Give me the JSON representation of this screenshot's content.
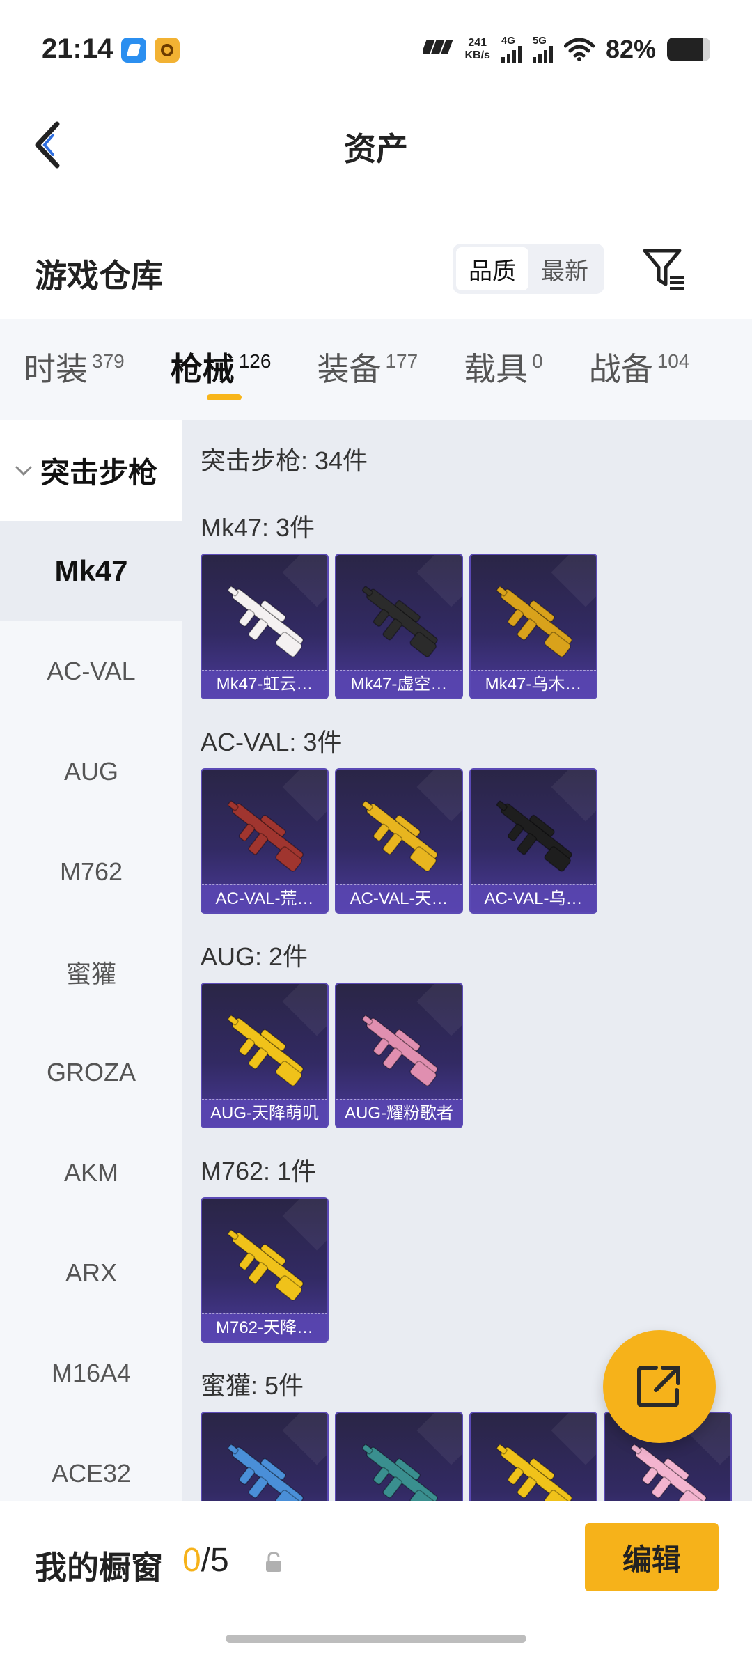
{
  "status_bar": {
    "time": "21:14",
    "network_speed_value": "241",
    "network_speed_unit": "KB/s",
    "sim1_label": "4G",
    "sim2_label": "5G",
    "battery_percent_text": "82%",
    "battery_level": 0.82,
    "icons": [
      "app-icon-blue",
      "app-icon-orange",
      "hd-icon",
      "signal-icon",
      "signal-icon",
      "wifi-icon",
      "battery-icon"
    ]
  },
  "header": {
    "title": "资产",
    "back_icon": "chevron-left-icon"
  },
  "warehouse": {
    "title": "游戏仓库",
    "sort_options": [
      "品质",
      "最新"
    ],
    "sort_selected": "品质",
    "filter_icon": "filter-icon"
  },
  "tabs": [
    {
      "label": "时装",
      "count": "379"
    },
    {
      "label": "枪械",
      "count": "126",
      "active": true
    },
    {
      "label": "装备",
      "count": "177"
    },
    {
      "label": "载具",
      "count": "0"
    },
    {
      "label": "战备",
      "count": "104"
    }
  ],
  "sidebar": {
    "group_label": "突击步枪",
    "items": [
      "Mk47",
      "AC-VAL",
      "AUG",
      "M762",
      "蜜獾",
      "GROZA",
      "AKM",
      "ARX",
      "M16A4",
      "ACE32"
    ],
    "selected": "Mk47"
  },
  "content": {
    "summary": "突击步枪: 34件",
    "sections": [
      {
        "heading": "Mk47: 3件",
        "items": [
          "Mk47-虹云…",
          "Mk47-虚空…",
          "Mk47-乌木…"
        ]
      },
      {
        "heading": "AC-VAL: 3件",
        "items": [
          "AC-VAL-荒…",
          "AC-VAL-天…",
          "AC-VAL-乌…"
        ]
      },
      {
        "heading": "AUG: 2件",
        "items": [
          "AUG-天降萌叽",
          "AUG-耀粉歌者"
        ]
      },
      {
        "heading": "M762: 1件",
        "items": [
          "M762-天降…"
        ]
      },
      {
        "heading": "蜜獾: 5件",
        "items": [
          "",
          "",
          "",
          ""
        ]
      }
    ],
    "item_colors": [
      "#f4f1f1",
      "#2b2b2b",
      "#d9a21b",
      "#a0352f",
      "#e8b51f",
      "#1e1e1e",
      "#f0c21a",
      "#e08fb0",
      "#f0c21a",
      "#4a8fd8",
      "#3a8f8f",
      "#f0c21a",
      "#f3b4cf"
    ]
  },
  "fab": {
    "icon": "share-external-icon"
  },
  "bottom_bar": {
    "label": "我的橱窗",
    "count_current": "0",
    "count_sep_total": "/5",
    "lock_icon": "lock-icon",
    "edit_label": "编辑"
  }
}
